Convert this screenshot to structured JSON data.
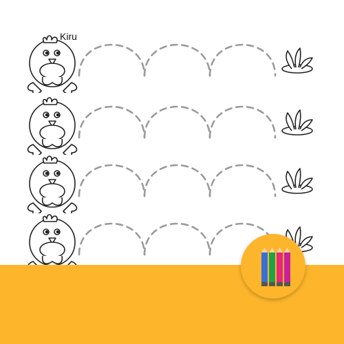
{
  "worksheet": {
    "brand": "Kiru",
    "rows": [
      {
        "character": "chick-icon",
        "path": "dashed-arcs",
        "goal": "grass-tuft-icon"
      },
      {
        "character": "chick-icon",
        "path": "dashed-arcs",
        "goal": "grass-tuft-icon"
      },
      {
        "character": "chick-icon",
        "path": "dashed-arcs",
        "goal": "grass-tuft-icon"
      },
      {
        "character": "chick-icon",
        "path": "dashed-arcs",
        "goal": "grass-tuft-icon"
      }
    ]
  },
  "colors": {
    "band": "#fdb52b",
    "badge": "#fdb52b",
    "dash": "#9a9a9a",
    "outline": "#222222",
    "pencils": [
      "#3a6fd8",
      "#1ea34a",
      "#e8287b",
      "#c8209a"
    ]
  }
}
